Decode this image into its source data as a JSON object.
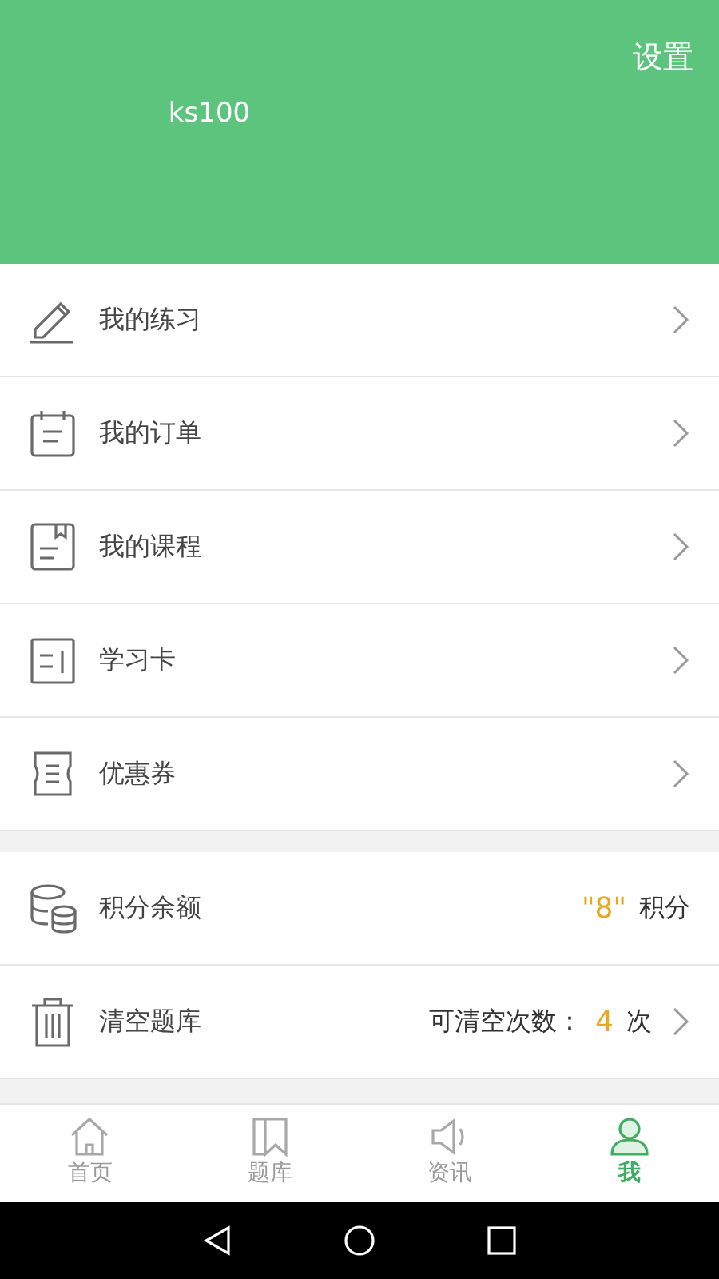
{
  "header": {
    "settings": "设置",
    "username": "ks100"
  },
  "menu_items": [
    {
      "label": "我的练习"
    },
    {
      "label": "我的订单"
    },
    {
      "label": "我的课程"
    },
    {
      "label": "学习卡"
    },
    {
      "label": "优惠券"
    }
  ],
  "account_rows": [
    {
      "kind": "points",
      "label": "积分余额",
      "value": "\"8\"",
      "unit": "积分"
    },
    {
      "kind": "clear",
      "label": "清空题库",
      "prefix": "可清空次数：",
      "value": "4",
      "unit": "次"
    }
  ],
  "tabs": [
    {
      "label": "首页",
      "selected": false
    },
    {
      "label": "题库",
      "selected": false
    },
    {
      "label": "资讯",
      "selected": false
    },
    {
      "label": "我",
      "selected": true
    }
  ]
}
